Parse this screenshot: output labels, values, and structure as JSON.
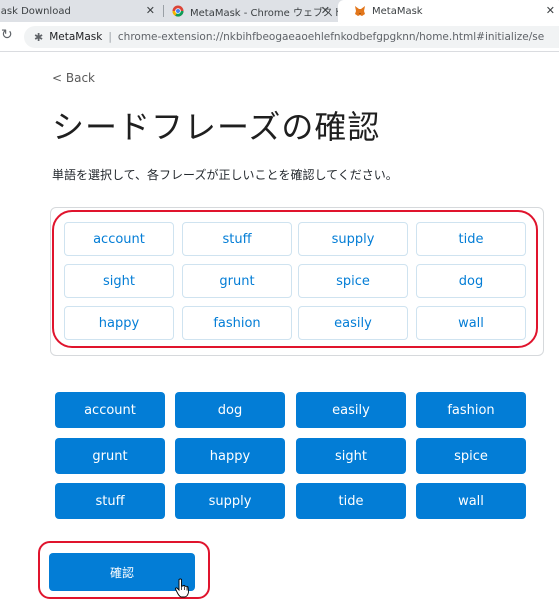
{
  "browser": {
    "tabs": [
      {
        "title": "lask Download",
        "active": false
      },
      {
        "title": "MetaMask - Chrome ウェブストア",
        "active": false
      },
      {
        "title": "MetaMask",
        "active": true
      }
    ],
    "omnibox": {
      "site": "MetaMask",
      "url": "chrome-extension://nkbihfbeogaeaoehlefnkodbefgpgknn/home.html#initialize/se"
    }
  },
  "page": {
    "back_label": "< Back",
    "title": "シードフレーズの確認",
    "description": "単語を選択して、各フレーズが正しいことを確認してください。",
    "selected_words": [
      "account",
      "stuff",
      "supply",
      "tide",
      "sight",
      "grunt",
      "spice",
      "dog",
      "happy",
      "fashion",
      "easily",
      "wall"
    ],
    "word_bank": [
      "account",
      "dog",
      "easily",
      "fashion",
      "grunt",
      "happy",
      "sight",
      "spice",
      "stuff",
      "supply",
      "tide",
      "wall"
    ],
    "confirm_label": "確認"
  },
  "colors": {
    "accent": "#037dd6",
    "highlight": "#e0142d"
  }
}
